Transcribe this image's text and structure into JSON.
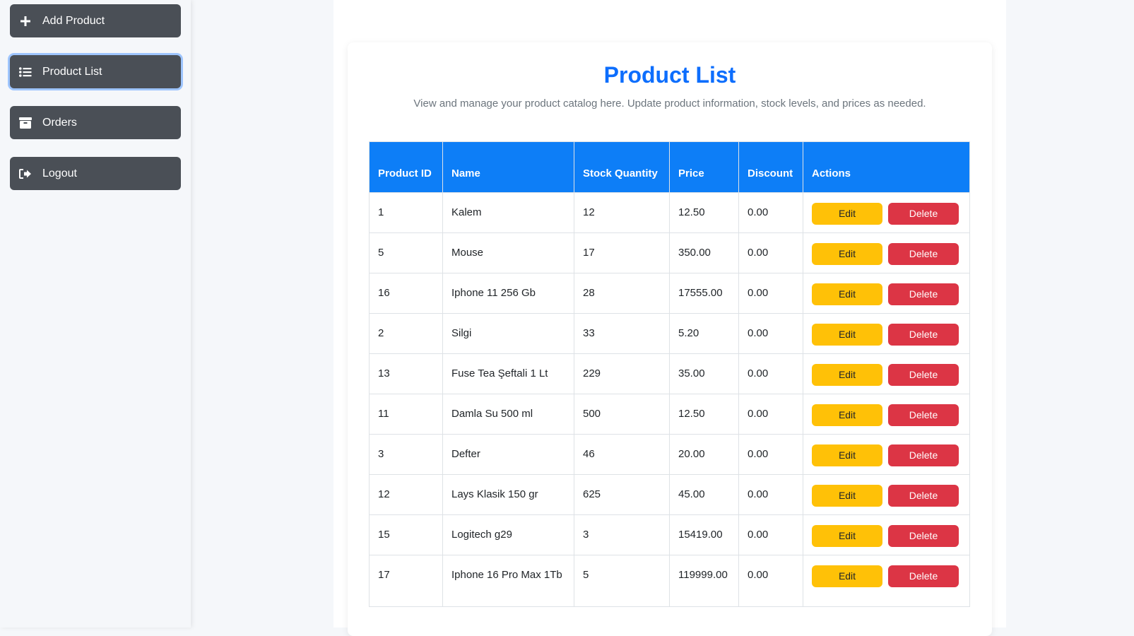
{
  "sidebar": {
    "items": [
      {
        "label": "Add Product",
        "icon": "plus-icon"
      },
      {
        "label": "Product List",
        "icon": "list-icon"
      },
      {
        "label": "Orders",
        "icon": "box-icon"
      },
      {
        "label": "Logout",
        "icon": "logout-icon"
      }
    ]
  },
  "main": {
    "title": "Product List",
    "subtitle": "View and manage your product catalog here. Update product information, stock levels, and prices as needed."
  },
  "table": {
    "headers": [
      "Product ID",
      "Name",
      "Stock Quantity",
      "Price",
      "Discount",
      "Actions"
    ],
    "edit_label": "Edit",
    "delete_label": "Delete",
    "rows": [
      [
        "1",
        "Kalem",
        "12",
        "12.50",
        "0.00"
      ],
      [
        "5",
        "Mouse",
        "17",
        "350.00",
        "0.00"
      ],
      [
        "16",
        "Iphone 11 256 Gb",
        "28",
        "17555.00",
        "0.00"
      ],
      [
        "2",
        "Silgi",
        "33",
        "5.20",
        "0.00"
      ],
      [
        "13",
        "Fuse Tea Şeftali 1 Lt",
        "229",
        "35.00",
        "0.00"
      ],
      [
        "11",
        "Damla Su 500 ml",
        "500",
        "12.50",
        "0.00"
      ],
      [
        "3",
        "Defter",
        "46",
        "20.00",
        "0.00"
      ],
      [
        "12",
        "Lays Klasik 150 gr",
        "625",
        "45.00",
        "0.00"
      ],
      [
        "15",
        "Logitech g29",
        "3",
        "15419.00",
        "0.00"
      ],
      [
        "17",
        "Iphone 16 Pro Max 1Tb",
        "5",
        "119999.00",
        "0.00"
      ]
    ]
  },
  "colors": {
    "primary": "#0d6efd",
    "edit": "#ffc107",
    "delete": "#dc3545",
    "nav": "#4a4f56"
  }
}
